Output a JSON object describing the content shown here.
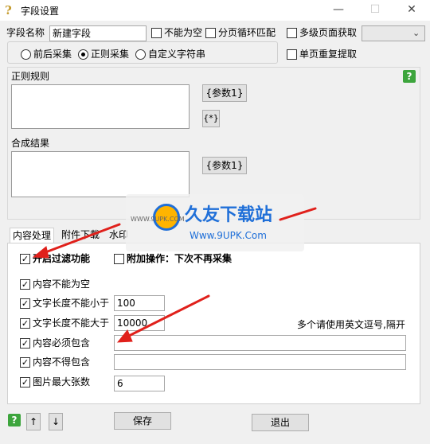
{
  "window": {
    "title": "字段设置",
    "minimize_glyph": "—",
    "maximize_glyph": "☐",
    "close_glyph": "✕"
  },
  "field": {
    "name_label": "字段名称",
    "name_value": "新建字段",
    "not_empty_label": "不能为空",
    "paging_loop_label": "分页循环匹配",
    "multi_level_label": "多级页面获取",
    "single_repeat_label": "单页重复提取",
    "level_select_value": ""
  },
  "mode": {
    "options": [
      "前后采集",
      "正则采集",
      "自定义字符串"
    ],
    "selected": "正则采集"
  },
  "regex": {
    "label": "正则规则",
    "param_button": "{参数1}",
    "star_button": "{*}"
  },
  "combine": {
    "label": "合成结果",
    "param_button": "{参数1}"
  },
  "help_glyph": "?",
  "tabs": [
    "内容处理",
    "附件下载",
    "水印"
  ],
  "filter": {
    "enable_label": "开启过滤功能",
    "enable_checked": true,
    "extra_label": "附加操作：下次不再采集",
    "extra_checked": false,
    "rows": [
      {
        "label": "内容不能为空",
        "checked": true,
        "value": null
      },
      {
        "label": "文字长度不能小于",
        "checked": true,
        "value": "100"
      },
      {
        "label": "文字长度不能大于",
        "checked": true,
        "value": "10000"
      },
      {
        "label": "内容必须包含",
        "checked": true,
        "value": ""
      },
      {
        "label": "内容不得包含",
        "checked": true,
        "value": ""
      },
      {
        "label": "图片最大张数",
        "checked": true,
        "value": "6"
      }
    ],
    "hint": "多个请使用英文逗号,隔开"
  },
  "footer": {
    "up_glyph": "↑",
    "down_glyph": "↓",
    "save_label": "保存",
    "exit_label": "退出"
  },
  "watermark": {
    "brand": "久友下载站",
    "url": "Www.9UPK.Com",
    "small": "WWW.9UPK.COM"
  },
  "colors": {
    "help_green": "#3da53d",
    "arrow_red": "#e0201b",
    "watermark_blue": "#1f6fd8"
  }
}
